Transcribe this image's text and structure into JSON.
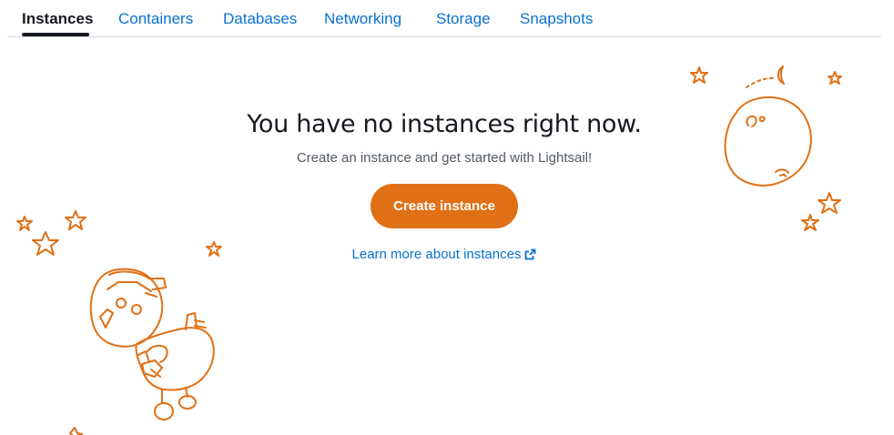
{
  "tabs": [
    {
      "label": "Instances",
      "active": true
    },
    {
      "label": "Containers",
      "active": false
    },
    {
      "label": "Databases",
      "active": false
    },
    {
      "label": "Networking",
      "active": false
    },
    {
      "label": "Storage",
      "active": false
    },
    {
      "label": "Snapshots",
      "active": false
    }
  ],
  "empty_state": {
    "headline": "You have no instances right now.",
    "subline": "Create an instance and get started with Lightsail!",
    "create_button_label": "Create instance",
    "learn_link_label": "Learn more about instances",
    "learn_link_icon": "external-link-icon"
  },
  "illustrations": {
    "left": "robot-astronaut-illustration",
    "right": "planet-moon-illustration",
    "decorations": "star-icon"
  },
  "colors": {
    "accent": "#e07016",
    "link": "#0972d3",
    "text": "#16191f",
    "muted_text": "#545b64",
    "divider": "#d5dbdb"
  }
}
